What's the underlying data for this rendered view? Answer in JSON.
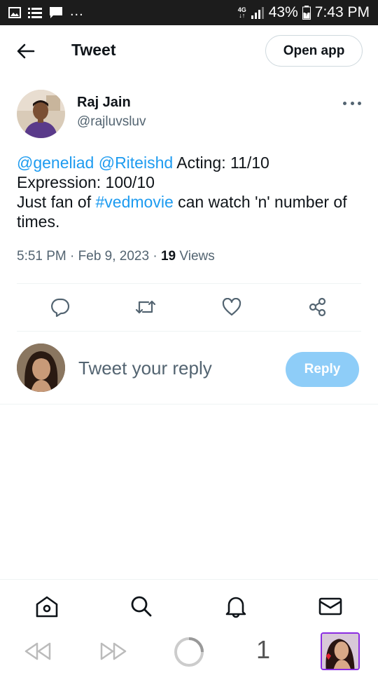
{
  "status_bar": {
    "network": "4G",
    "battery": "43%",
    "time": "7:43 PM",
    "more": "..."
  },
  "header": {
    "title": "Tweet",
    "open_app_label": "Open app"
  },
  "tweet": {
    "author_name": "Raj Jain",
    "author_handle": "@rajluvsluv",
    "mention1": "@geneliad",
    "mention2": "@Riteishd",
    "text_part1": "Acting: 11/10",
    "text_line2": "Expression: 100/10",
    "text_line3_start": "Just fan of",
    "hashtag": "#vedmovie",
    "text_line3_end": "can watch 'n' number of times.",
    "time": "5:51 PM",
    "date": "Feb 9, 2023",
    "views_count": "19",
    "views_label": "Views"
  },
  "reply": {
    "placeholder": "Tweet your reply",
    "button_label": "Reply"
  },
  "android_nav": {
    "page_number": "1"
  },
  "colors": {
    "accent": "#1d9bf0",
    "reply_button": "#8ecdf8",
    "text_primary": "#0f1419",
    "text_secondary": "#536471"
  }
}
